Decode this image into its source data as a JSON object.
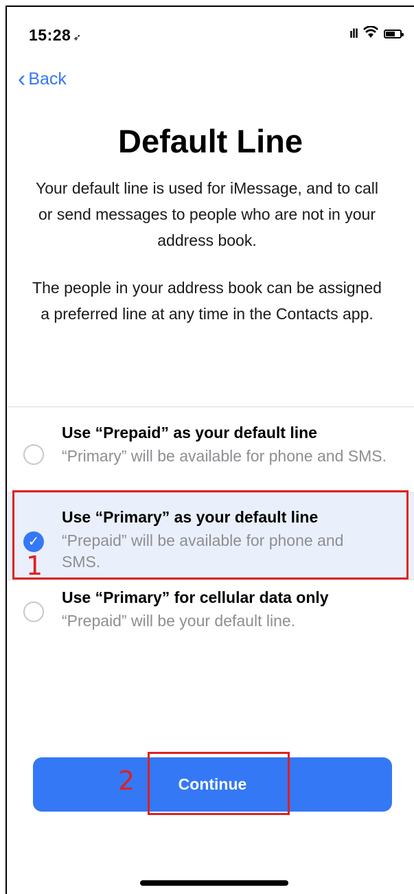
{
  "status": {
    "time": "15:28",
    "location_arrow": "➶"
  },
  "nav": {
    "back_label": "Back"
  },
  "page": {
    "title": "Default Line",
    "description_1": "Your default line is used for iMessage, and to call or send messages to people who are not in your address book.",
    "description_2": "The people in your address book can be assigned a preferred line at any time in the Contacts app."
  },
  "options": [
    {
      "title": "Use “Prepaid” as your default line",
      "subtitle": "“Primary” will be available for phone and SMS.",
      "selected": false
    },
    {
      "title": "Use “Primary” as your default line",
      "subtitle": "“Prepaid” will be available for phone and SMS.",
      "selected": true
    },
    {
      "title": "Use “Primary” for cellular data only",
      "subtitle": "“Prepaid” will be your default line.",
      "selected": false
    }
  ],
  "annotations": {
    "step1": "1",
    "step2": "2"
  },
  "continue_label": "Continue",
  "colors": {
    "accent": "#3478f6",
    "annotation": "#e02020",
    "selected_row": "#eaf0fb"
  }
}
